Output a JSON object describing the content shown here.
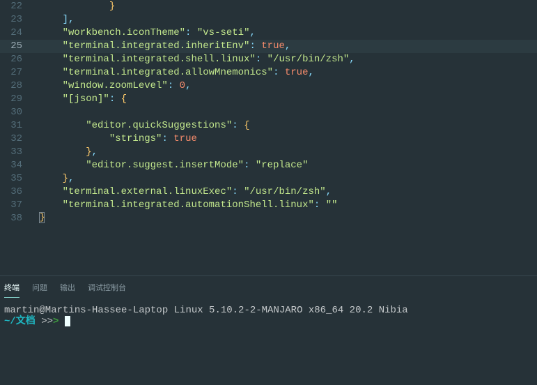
{
  "editor": {
    "highlightedLine": 25,
    "lines": [
      {
        "num": 22,
        "tokens": [
          {
            "t": "indent",
            "n": 3
          },
          {
            "t": "brace",
            "v": "}"
          }
        ]
      },
      {
        "num": 23,
        "tokens": [
          {
            "t": "indent",
            "n": 1
          },
          {
            "t": "punc",
            "v": "],"
          }
        ]
      },
      {
        "num": 24,
        "tokens": [
          {
            "t": "indent",
            "n": 1
          },
          {
            "t": "key",
            "v": "\"workbench.iconTheme\""
          },
          {
            "t": "colon",
            "v": ":"
          },
          {
            "t": "sp",
            "v": " "
          },
          {
            "t": "str",
            "v": "\"vs-seti\""
          },
          {
            "t": "punc",
            "v": ","
          }
        ]
      },
      {
        "num": 25,
        "tokens": [
          {
            "t": "indent",
            "n": 1
          },
          {
            "t": "key",
            "v": "\"terminal.integrated.inheritEnv\""
          },
          {
            "t": "colon",
            "v": ":"
          },
          {
            "t": "sp",
            "v": " "
          },
          {
            "t": "true",
            "v": "true"
          },
          {
            "t": "punc",
            "v": ","
          }
        ]
      },
      {
        "num": 26,
        "tokens": [
          {
            "t": "indent",
            "n": 1
          },
          {
            "t": "key",
            "v": "\"terminal.integrated.shell.linux\""
          },
          {
            "t": "colon",
            "v": ":"
          },
          {
            "t": "sp",
            "v": " "
          },
          {
            "t": "str",
            "v": "\"/usr/bin/zsh\""
          },
          {
            "t": "punc",
            "v": ","
          }
        ]
      },
      {
        "num": 27,
        "tokens": [
          {
            "t": "indent",
            "n": 1
          },
          {
            "t": "key",
            "v": "\"terminal.integrated.allowMnemonics\""
          },
          {
            "t": "colon",
            "v": ":"
          },
          {
            "t": "sp",
            "v": " "
          },
          {
            "t": "true",
            "v": "true"
          },
          {
            "t": "punc",
            "v": ","
          }
        ]
      },
      {
        "num": 28,
        "tokens": [
          {
            "t": "indent",
            "n": 1
          },
          {
            "t": "key",
            "v": "\"window.zoomLevel\""
          },
          {
            "t": "colon",
            "v": ":"
          },
          {
            "t": "sp",
            "v": " "
          },
          {
            "t": "num",
            "v": "0"
          },
          {
            "t": "punc",
            "v": ","
          }
        ]
      },
      {
        "num": 29,
        "tokens": [
          {
            "t": "indent",
            "n": 1
          },
          {
            "t": "key",
            "v": "\"[json]\""
          },
          {
            "t": "colon",
            "v": ":"
          },
          {
            "t": "sp",
            "v": " "
          },
          {
            "t": "brace",
            "v": "{"
          }
        ]
      },
      {
        "num": 30,
        "tokens": [
          {
            "t": "indent",
            "n": 1
          }
        ]
      },
      {
        "num": 31,
        "tokens": [
          {
            "t": "indent",
            "n": 2
          },
          {
            "t": "key",
            "v": "\"editor.quickSuggestions\""
          },
          {
            "t": "colon",
            "v": ":"
          },
          {
            "t": "sp",
            "v": " "
          },
          {
            "t": "brace",
            "v": "{"
          }
        ]
      },
      {
        "num": 32,
        "tokens": [
          {
            "t": "indent",
            "n": 3
          },
          {
            "t": "key",
            "v": "\"strings\""
          },
          {
            "t": "colon",
            "v": ":"
          },
          {
            "t": "sp",
            "v": " "
          },
          {
            "t": "true",
            "v": "true"
          }
        ]
      },
      {
        "num": 33,
        "tokens": [
          {
            "t": "indent",
            "n": 2
          },
          {
            "t": "brace",
            "v": "}"
          },
          {
            "t": "punc",
            "v": ","
          }
        ]
      },
      {
        "num": 34,
        "tokens": [
          {
            "t": "indent",
            "n": 2
          },
          {
            "t": "key",
            "v": "\"editor.suggest.insertMode\""
          },
          {
            "t": "colon",
            "v": ":"
          },
          {
            "t": "sp",
            "v": " "
          },
          {
            "t": "str",
            "v": "\"replace\""
          }
        ]
      },
      {
        "num": 35,
        "tokens": [
          {
            "t": "indent",
            "n": 1
          },
          {
            "t": "brace",
            "v": "}"
          },
          {
            "t": "punc",
            "v": ","
          }
        ]
      },
      {
        "num": 36,
        "tokens": [
          {
            "t": "indent",
            "n": 1
          },
          {
            "t": "key",
            "v": "\"terminal.external.linuxExec\""
          },
          {
            "t": "colon",
            "v": ":"
          },
          {
            "t": "sp",
            "v": " "
          },
          {
            "t": "str",
            "v": "\"/usr/bin/zsh\""
          },
          {
            "t": "punc",
            "v": ","
          }
        ]
      },
      {
        "num": 37,
        "tokens": [
          {
            "t": "indent",
            "n": 1
          },
          {
            "t": "key",
            "v": "\"terminal.integrated.automationShell.linux\""
          },
          {
            "t": "colon",
            "v": ":"
          },
          {
            "t": "sp",
            "v": " "
          },
          {
            "t": "str",
            "v": "\"\""
          }
        ]
      },
      {
        "num": 38,
        "tokens": [
          {
            "t": "braceEnd",
            "v": "}"
          }
        ]
      }
    ]
  },
  "panel": {
    "tabs": [
      {
        "label": "终端",
        "active": true
      },
      {
        "label": "问题",
        "active": false
      },
      {
        "label": "输出",
        "active": false
      },
      {
        "label": "调试控制台",
        "active": false
      }
    ],
    "terminal": {
      "line1": "martin@Martins-Hassee-Laptop Linux 5.10.2-2-MANJARO x86_64 20.2 Nibia",
      "cwd": "~/文档",
      "prompt_gray": " >>",
      "prompt_green": "> "
    }
  }
}
